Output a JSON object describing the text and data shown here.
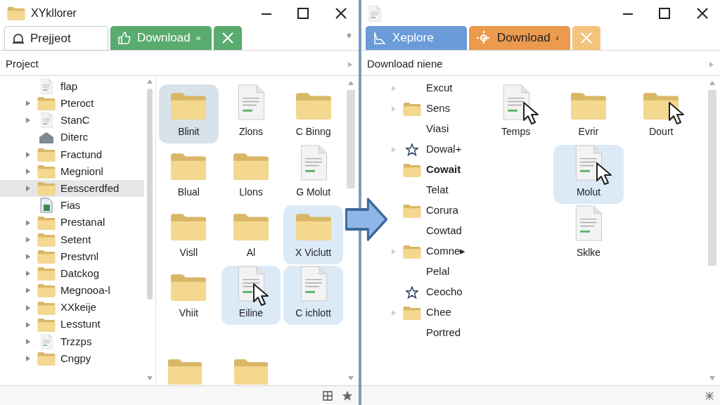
{
  "windows": [
    {
      "title": "XYkllorer",
      "tabs": [
        {
          "kind": "label",
          "label": "Prejjeot",
          "selected": true,
          "color": "#ffffff"
        },
        {
          "kind": "label",
          "label": "Download",
          "suffix": "«",
          "selected": false,
          "color": "#5aab6f"
        },
        {
          "kind": "close",
          "selected": false,
          "color": "#5aab6f"
        }
      ],
      "tab_extra": "*",
      "header": "Project",
      "tree": [
        {
          "name": "flap",
          "kind": "file",
          "collapsed": false,
          "selected": false
        },
        {
          "name": "Pteroct",
          "kind": "folder",
          "collapsed": true,
          "selected": false
        },
        {
          "name": "StanC",
          "kind": "file",
          "collapsed": true,
          "selected": false
        },
        {
          "name": "Diterc",
          "kind": "home",
          "collapsed": false,
          "selected": false
        },
        {
          "name": "Fractund",
          "kind": "folder",
          "collapsed": true,
          "selected": false
        },
        {
          "name": "Megnionl",
          "kind": "folder",
          "collapsed": true,
          "selected": false
        },
        {
          "name": "Eesscerdfed",
          "kind": "folder",
          "collapsed": true,
          "selected": true
        },
        {
          "name": "Fias",
          "kind": "image",
          "collapsed": false,
          "selected": false
        },
        {
          "name": "Prestanal",
          "kind": "folder",
          "collapsed": true,
          "selected": false
        },
        {
          "name": "Setent",
          "kind": "folder",
          "collapsed": true,
          "selected": false
        },
        {
          "name": "Prestvnl",
          "kind": "folder",
          "collapsed": true,
          "selected": false
        },
        {
          "name": "Datckog",
          "kind": "folder",
          "collapsed": true,
          "selected": false
        },
        {
          "name": "Megnooa-l",
          "kind": "folder",
          "collapsed": true,
          "selected": false
        },
        {
          "name": "XXkeije",
          "kind": "folder",
          "collapsed": true,
          "selected": false
        },
        {
          "name": "Lesstunt",
          "kind": "folder",
          "collapsed": true,
          "selected": false
        },
        {
          "name": "Trzzps",
          "kind": "file",
          "collapsed": true,
          "selected": false
        },
        {
          "name": "Cngpy",
          "kind": "folder",
          "collapsed": true,
          "selected": false
        }
      ],
      "grid": [
        {
          "name": "Blinit",
          "kind": "folder",
          "selected": true,
          "cursor": false
        },
        {
          "name": "Zlons",
          "kind": "file",
          "selected": false,
          "cursor": false
        },
        {
          "name": "C Binng",
          "kind": "folder",
          "selected": false,
          "cursor": false
        },
        {
          "name": "Blual",
          "kind": "folder",
          "selected": false,
          "cursor": false
        },
        {
          "name": "Llons",
          "kind": "folder",
          "selected": false,
          "cursor": false
        },
        {
          "name": "G Molut",
          "kind": "file",
          "selected": false,
          "cursor": false
        },
        {
          "name": "Visll",
          "kind": "folder",
          "selected": false,
          "cursor": false
        },
        {
          "name": "Al",
          "kind": "folder",
          "selected": false,
          "cursor": false
        },
        {
          "name": "X Viclutt",
          "kind": "folder",
          "selected": true,
          "cursor": false
        },
        {
          "name": "Vhiit",
          "kind": "folder",
          "selected": false,
          "cursor": false
        },
        {
          "name": "Eiline",
          "kind": "file",
          "selected": true,
          "cursor": true
        },
        {
          "name": "C ichlott",
          "kind": "file",
          "selected": true,
          "cursor": false
        }
      ]
    },
    {
      "tabs": [
        {
          "kind": "label",
          "label": "Xeplore",
          "selected": false,
          "color": "#6b9bd8"
        },
        {
          "kind": "label",
          "label": "Download",
          "suffix": "‹",
          "selected": false,
          "color": "#eb9a4e"
        },
        {
          "kind": "close",
          "selected": false,
          "color": "#f4c47e"
        }
      ],
      "header": "Download niene",
      "tree": [
        {
          "name": "Excut",
          "kind": "none",
          "collapsed": true,
          "selected": false
        },
        {
          "name": "Sens",
          "kind": "folder",
          "collapsed": true,
          "selected": false
        },
        {
          "name": "Viasi",
          "kind": "none",
          "collapsed": false,
          "selected": false
        },
        {
          "name": "Dowal+",
          "kind": "star",
          "collapsed": true,
          "selected": false
        },
        {
          "name": "Cowait",
          "kind": "folder",
          "collapsed": false,
          "selected": true
        },
        {
          "name": "Telat",
          "kind": "none",
          "collapsed": false,
          "selected": false
        },
        {
          "name": "Corura",
          "kind": "folder",
          "collapsed": false,
          "selected": false
        },
        {
          "name": "Cowtad",
          "kind": "none",
          "collapsed": false,
          "selected": false
        },
        {
          "name": "Comne▸",
          "kind": "folder",
          "collapsed": true,
          "selected": false
        },
        {
          "name": "Pelal",
          "kind": "none",
          "collapsed": false,
          "selected": false
        },
        {
          "name": "Ceocho",
          "kind": "star",
          "collapsed": false,
          "selected": false
        },
        {
          "name": "Chee",
          "kind": "folder",
          "collapsed": true,
          "selected": false
        },
        {
          "name": "Portred",
          "kind": "none",
          "collapsed": false,
          "selected": false
        }
      ],
      "grid": [
        {
          "name": "Temps",
          "kind": "file",
          "selected": false,
          "cursor": true
        },
        {
          "name": "Evrir",
          "kind": "folder",
          "selected": false,
          "cursor": false
        },
        {
          "name": "Dourt",
          "kind": "folder",
          "selected": false,
          "cursor": true
        },
        {
          "name": "Molut",
          "kind": "file",
          "selected": true,
          "cursor": true
        },
        {
          "name": "Sklke",
          "kind": "file",
          "selected": false,
          "cursor": false
        }
      ]
    }
  ]
}
